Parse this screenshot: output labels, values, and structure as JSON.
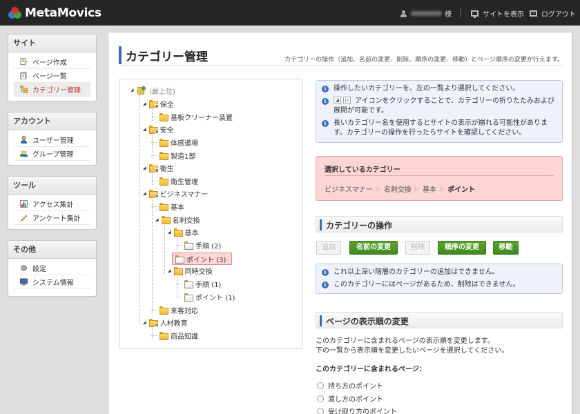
{
  "header": {
    "logo_text": "MetaMovics",
    "user_suffix": "様",
    "view_site": "サイトを表示",
    "logout": "ログアウト"
  },
  "sidebar": {
    "sections": [
      {
        "title": "サイト",
        "items": [
          {
            "label": "ページ作成",
            "icon": "page-create-icon"
          },
          {
            "label": "ページ一覧",
            "icon": "page-list-icon"
          },
          {
            "label": "カテゴリー管理",
            "icon": "category-icon",
            "active": true
          }
        ]
      },
      {
        "title": "アカウント",
        "items": [
          {
            "label": "ユーザー管理",
            "icon": "user-icon"
          },
          {
            "label": "グループ管理",
            "icon": "group-icon"
          }
        ]
      },
      {
        "title": "ツール",
        "items": [
          {
            "label": "アクセス集計",
            "icon": "chart-icon"
          },
          {
            "label": "アンケート集計",
            "icon": "survey-icon"
          }
        ]
      },
      {
        "title": "その他",
        "items": [
          {
            "label": "設定",
            "icon": "gear-icon"
          },
          {
            "label": "システム情報",
            "icon": "monitor-icon"
          }
        ]
      }
    ]
  },
  "page": {
    "title": "カテゴリー管理",
    "description": "カテゴリーの操作（追加、名前の変更、削除、順序の変更、移動）とページ順序の変更が行えます。"
  },
  "tree": {
    "root": "(最上位)",
    "nodes": [
      {
        "label": "保全",
        "level": 1
      },
      {
        "label": "基板クリーナー装置",
        "level": 2
      },
      {
        "label": "安全",
        "level": 1
      },
      {
        "label": "体感道場",
        "level": 2
      },
      {
        "label": "製造1部",
        "level": 2
      },
      {
        "label": "衛生",
        "level": 1
      },
      {
        "label": "衛生管理",
        "level": 2
      },
      {
        "label": "ビジネスマナー",
        "level": 1
      },
      {
        "label": "基本",
        "level": 2
      },
      {
        "label": "名刺交換",
        "level": 2
      },
      {
        "label": "基本",
        "level": 3
      },
      {
        "label": "手順 (2)",
        "level": 4
      },
      {
        "label": "ポイント (3)",
        "level": 4,
        "selected": true
      },
      {
        "label": "同時交換",
        "level": 3
      },
      {
        "label": "手順 (1)",
        "level": 4
      },
      {
        "label": "ポイント (1)",
        "level": 4
      },
      {
        "label": "来客対応",
        "level": 2
      },
      {
        "label": "人材教育",
        "level": 1
      },
      {
        "label": "商品知識",
        "level": 2
      }
    ]
  },
  "info": {
    "line1": "操作したいカテゴリーを、左の一覧より選択してください。",
    "line2": "アイコンをクリックすることで、カテゴリーの折りたたみおよび展開が可能です。",
    "line3": "長いカテゴリー名を使用するとサイトの表示が崩れる可能性があります。カテゴリーの操作を行ったらサイトを確認してください。"
  },
  "selected_category": {
    "title": "選択しているカテゴリー",
    "path": [
      "ビジネスマナー",
      "名刺交換",
      "基本",
      "ポイント"
    ]
  },
  "operations": {
    "heading": "カテゴリーの操作",
    "buttons": {
      "add": "追加",
      "rename": "名前の変更",
      "delete": "削除",
      "reorder": "順序の変更",
      "move": "移動"
    },
    "notice1": "これ以上深い階層のカテゴリーの追加はできません。",
    "notice2": "このカテゴリーにはページがあるため、削除はできません。"
  },
  "page_order": {
    "heading": "ページの表示順の変更",
    "desc1": "このカテゴリーに含まれるページの表示順を変更します。",
    "desc2": "下の一覧から表示順を変更したいページを選択してください。",
    "pages_label": "このカテゴリーに含まれるページ：",
    "pages": [
      "持ち方のポイント",
      "渡し方のポイント",
      "受け取り方のポイント"
    ]
  }
}
